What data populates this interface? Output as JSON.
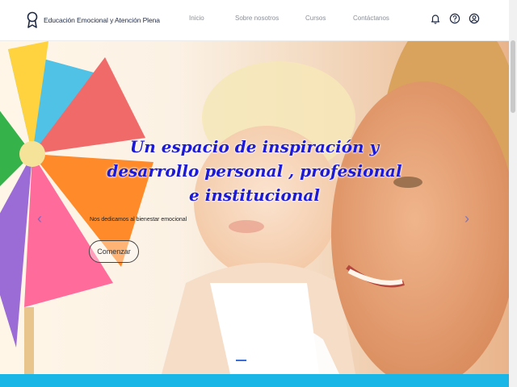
{
  "brand": {
    "name": "Educación Emocional y Atención Plena",
    "logo_icon": "ribbon-award-icon"
  },
  "nav": {
    "links": [
      "Inicio",
      "Sobre nosotros",
      "Cursos",
      "Contáctanos"
    ],
    "icons": [
      "bell-icon",
      "help-circle-icon",
      "user-circle-icon"
    ]
  },
  "hero": {
    "title": "Un espacio de inspiración y desarrollo personal , profesional e institucional",
    "subtitle": "Nos dedicamos al bienestar emocional",
    "button_label": "Comenzar",
    "prev_arrow": "‹",
    "next_arrow": "›",
    "slides_total": 3,
    "active_slide": 1
  },
  "colors": {
    "title": "#1c1ad6",
    "accent_band": "#19b6e6",
    "indicator_active": "#3b6fd6"
  }
}
